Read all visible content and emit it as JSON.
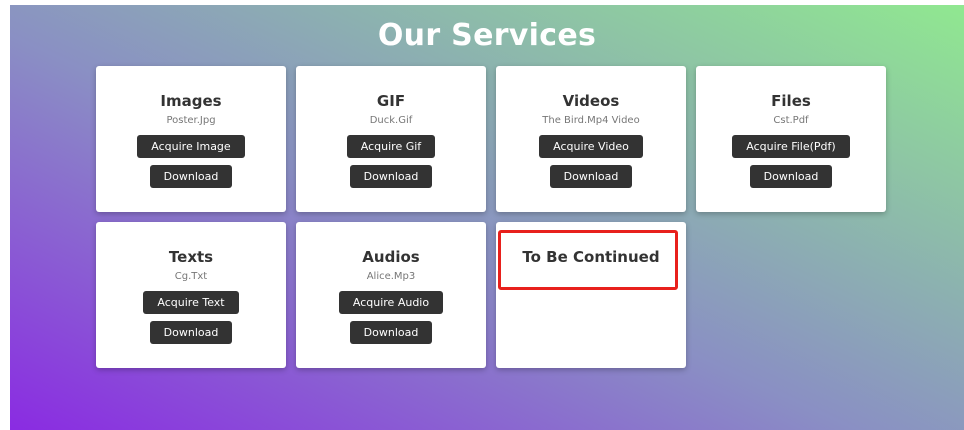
{
  "header": {
    "title": "Our Services"
  },
  "cards": [
    {
      "title": "Images",
      "file": "Poster.Jpg",
      "acquire_label": "Acquire Image",
      "download_label": "Download"
    },
    {
      "title": "GIF",
      "file": "Duck.Gif",
      "acquire_label": "Acquire Gif",
      "download_label": "Download"
    },
    {
      "title": "Videos",
      "file": "The Bird.Mp4 Video",
      "acquire_label": "Acquire Video",
      "download_label": "Download"
    },
    {
      "title": "Files",
      "file": "Cst.Pdf",
      "acquire_label": "Acquire File(Pdf)",
      "download_label": "Download"
    },
    {
      "title": "Texts",
      "file": "Cg.Txt",
      "acquire_label": "Acquire Text",
      "download_label": "Download"
    },
    {
      "title": "Audios",
      "file": "Alice.Mp3",
      "acquire_label": "Acquire Audio",
      "download_label": "Download"
    }
  ],
  "placeholder_card": {
    "title": "To Be Continued",
    "highlight_color": "#e8201c"
  },
  "colors": {
    "gradient_start": "#8a2be2",
    "gradient_end": "#90e890",
    "button_bg": "#333333"
  }
}
